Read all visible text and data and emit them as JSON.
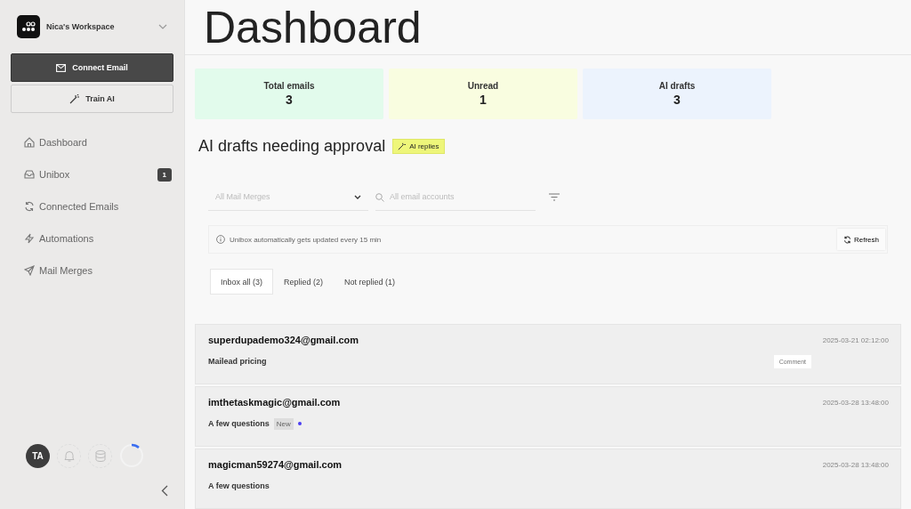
{
  "workspace": {
    "name": "Nica's Workspace"
  },
  "actions": [
    {
      "kind": "primary",
      "label": "Connect Email"
    },
    {
      "kind": "secondary",
      "label": "Train AI"
    }
  ],
  "nav": [
    {
      "label": "Dashboard"
    },
    {
      "label": "Unibox",
      "badge": "1"
    },
    {
      "label": "Connected Emails"
    },
    {
      "label": "Automations"
    },
    {
      "label": "Mail Merges"
    }
  ],
  "user": {
    "initials": "TA"
  },
  "page": {
    "title": "Dashboard"
  },
  "stats": [
    {
      "label": "Total emails",
      "value": "3",
      "color": "#e2fbec"
    },
    {
      "label": "Unread",
      "value": "1",
      "color": "#f9fde0"
    },
    {
      "label": "AI drafts",
      "value": "3",
      "color": "#ecf3fd"
    }
  ],
  "section": {
    "title": "AI drafts needing approval",
    "tag": "AI replies"
  },
  "filters": {
    "merge_placeholder": "All Mail Merges",
    "account_placeholder": "All email accounts"
  },
  "info": {
    "text": "Unibox automatically gets updated every 15 min",
    "button": "Refresh"
  },
  "tabs": [
    {
      "label": "Inbox all (3)",
      "selected": true
    },
    {
      "label": "Replied (2)",
      "selected": false
    },
    {
      "label": "Not replied (1)",
      "selected": false
    }
  ],
  "emails": [
    {
      "from": "superdupademo324@gmail.com",
      "subject": "Mailead pricing",
      "time": "2025-03-21 02:12:00",
      "unread": false,
      "comment": "Comment"
    },
    {
      "from": "imthetaskmagic@gmail.com",
      "subject": "A few questions",
      "time": "2025-03-28 13:48:00",
      "tag": "New",
      "unread": true
    },
    {
      "from": "magicman59274@gmail.com",
      "subject": "A few questions",
      "time": "2025-03-28 13:48:00",
      "unread": false
    }
  ]
}
